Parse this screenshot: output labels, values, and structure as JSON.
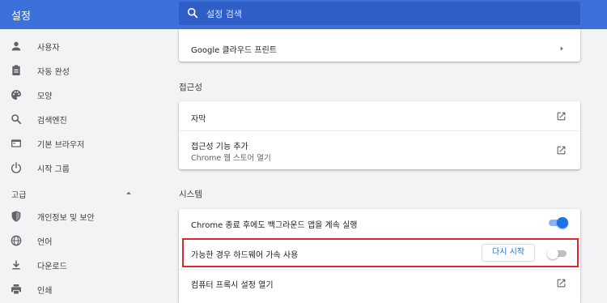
{
  "colors": {
    "accent": "#3c71d9",
    "toggle_on": "#1a73e8",
    "highlight": "#e0262e"
  },
  "header": {
    "title": "설정",
    "search": {
      "placeholder": "설정 검색",
      "icon": "search-icon"
    }
  },
  "sidebar": {
    "items": [
      {
        "label": "사용자",
        "icon": "person-icon"
      },
      {
        "label": "자동 완성",
        "icon": "clipboard-icon"
      },
      {
        "label": "모양",
        "icon": "palette-icon"
      },
      {
        "label": "검색엔진",
        "icon": "search-icon"
      },
      {
        "label": "기본 브라우저",
        "icon": "browser-icon"
      },
      {
        "label": "시작 그룹",
        "icon": "power-icon"
      }
    ],
    "advanced": {
      "label": "고급",
      "expanded": true
    },
    "advanced_items": [
      {
        "label": "개인정보 및 보안",
        "icon": "shield-icon"
      },
      {
        "label": "언어",
        "icon": "globe-icon"
      },
      {
        "label": "다운로드",
        "icon": "download-icon"
      },
      {
        "label": "인쇄",
        "icon": "printer-icon"
      }
    ]
  },
  "main": {
    "cloud_print": {
      "label": "Google 클라우드 프린트",
      "icon": "chevron-right-icon"
    },
    "accessibility": {
      "title": "접근성",
      "rows": [
        {
          "label": "자막",
          "icon": "open-in-new-icon"
        },
        {
          "label": "접근성 기능 추가",
          "sublabel": "Chrome 웹 스토어 열기",
          "icon": "open-in-new-icon"
        }
      ]
    },
    "system": {
      "title": "시스템",
      "background_apps": {
        "label": "Chrome 종료 후에도 백그라운드 앱을 계속 실행",
        "enabled": true
      },
      "hardware_accel": {
        "label": "가능한 경우 하드웨어 가속 사용",
        "enabled": false,
        "relaunch_label": "다시 시작"
      },
      "proxy": {
        "label": "컴퓨터 프록시 설정 열기",
        "icon": "open-in-new-icon"
      }
    }
  }
}
